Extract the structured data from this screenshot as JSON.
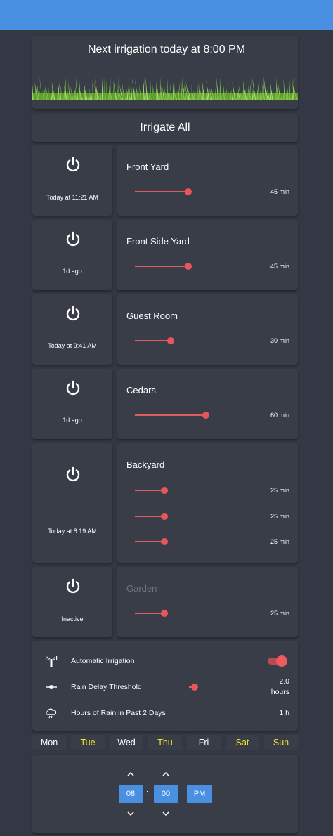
{
  "colors": {
    "topbar": "#4a90e2",
    "background": "#343844",
    "card": "#393d48",
    "accent": "#e8555b",
    "active_day": "#f5e42c",
    "picker": "#4a90e2"
  },
  "header": {
    "next_irrigation": "Next irrigation today at 8:00 PM"
  },
  "irrigate_all_label": "Irrigate All",
  "zones": [
    {
      "name": "Front Yard",
      "last_run": "Today at 11:21 AM",
      "durations": [
        "45 min"
      ]
    },
    {
      "name": "Front Side Yard",
      "last_run": "1d ago",
      "durations": [
        "45 min"
      ]
    },
    {
      "name": "Guest Room",
      "last_run": "Today at 9:41 AM",
      "durations": [
        "30 min"
      ]
    },
    {
      "name": "Cedars",
      "last_run": "1d ago",
      "durations": [
        "60 min"
      ]
    },
    {
      "name": "Backyard",
      "last_run": "Today at 8:19 AM",
      "durations": [
        "25 min",
        "25 min",
        "25 min"
      ]
    },
    {
      "name": "Garden",
      "last_run": "Inactive",
      "durations": [
        "25 min"
      ]
    }
  ],
  "settings": {
    "auto_irrigation": {
      "label": "Automatic Irrigation",
      "icon": "sprinkler-icon",
      "enabled": true
    },
    "rain_delay": {
      "label": "Rain Delay Threshold",
      "icon": "slider-icon",
      "value": "2.0",
      "unit": "hours"
    },
    "rain_hours": {
      "label": "Hours of Rain in Past 2 Days",
      "icon": "cloud-rain-icon",
      "value": "1 h"
    }
  },
  "schedule": {
    "days": [
      {
        "label": "Mon",
        "active": false
      },
      {
        "label": "Tue",
        "active": true
      },
      {
        "label": "Wed",
        "active": false
      },
      {
        "label": "Thu",
        "active": true
      },
      {
        "label": "Fri",
        "active": false
      },
      {
        "label": "Sat",
        "active": true
      },
      {
        "label": "Sun",
        "active": true
      }
    ],
    "hour": "08",
    "separator": ":",
    "minute": "00",
    "ampm": "PM"
  }
}
